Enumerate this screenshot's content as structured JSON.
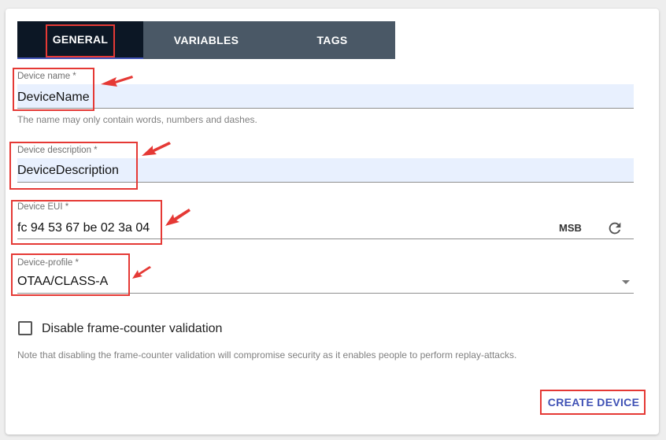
{
  "tabs": [
    {
      "label": "GENERAL",
      "active": true
    },
    {
      "label": "VARIABLES",
      "active": false
    },
    {
      "label": "TAGS",
      "active": false
    }
  ],
  "device_name": {
    "label": "Device name *",
    "value": "DeviceName",
    "helper": "The name may only contain words, numbers and dashes."
  },
  "device_description": {
    "label": "Device description *",
    "value": "DeviceDescription"
  },
  "device_eui": {
    "label": "Device EUI *",
    "value": "fc 94 53 67 be 02 3a 04",
    "byte_order": "MSB",
    "refresh_icon": "refresh-icon"
  },
  "device_profile": {
    "label": "Device-profile *",
    "value": "OTAA/CLASS-A",
    "dropdown_icon": "arrow-drop-down-icon"
  },
  "frame_counter": {
    "label": "Disable frame-counter validation",
    "checked": false,
    "note": "Note that disabling the frame-counter validation will compromise security as it enables people to perform replay-attacks."
  },
  "actions": {
    "create_label": "CREATE DEVICE"
  },
  "colors": {
    "tab_bar": "#4a5866",
    "tab_active": "#0c1725",
    "accent": "#3f51b5",
    "autofill": "#e8f0fe",
    "annotation": "#e53935"
  }
}
